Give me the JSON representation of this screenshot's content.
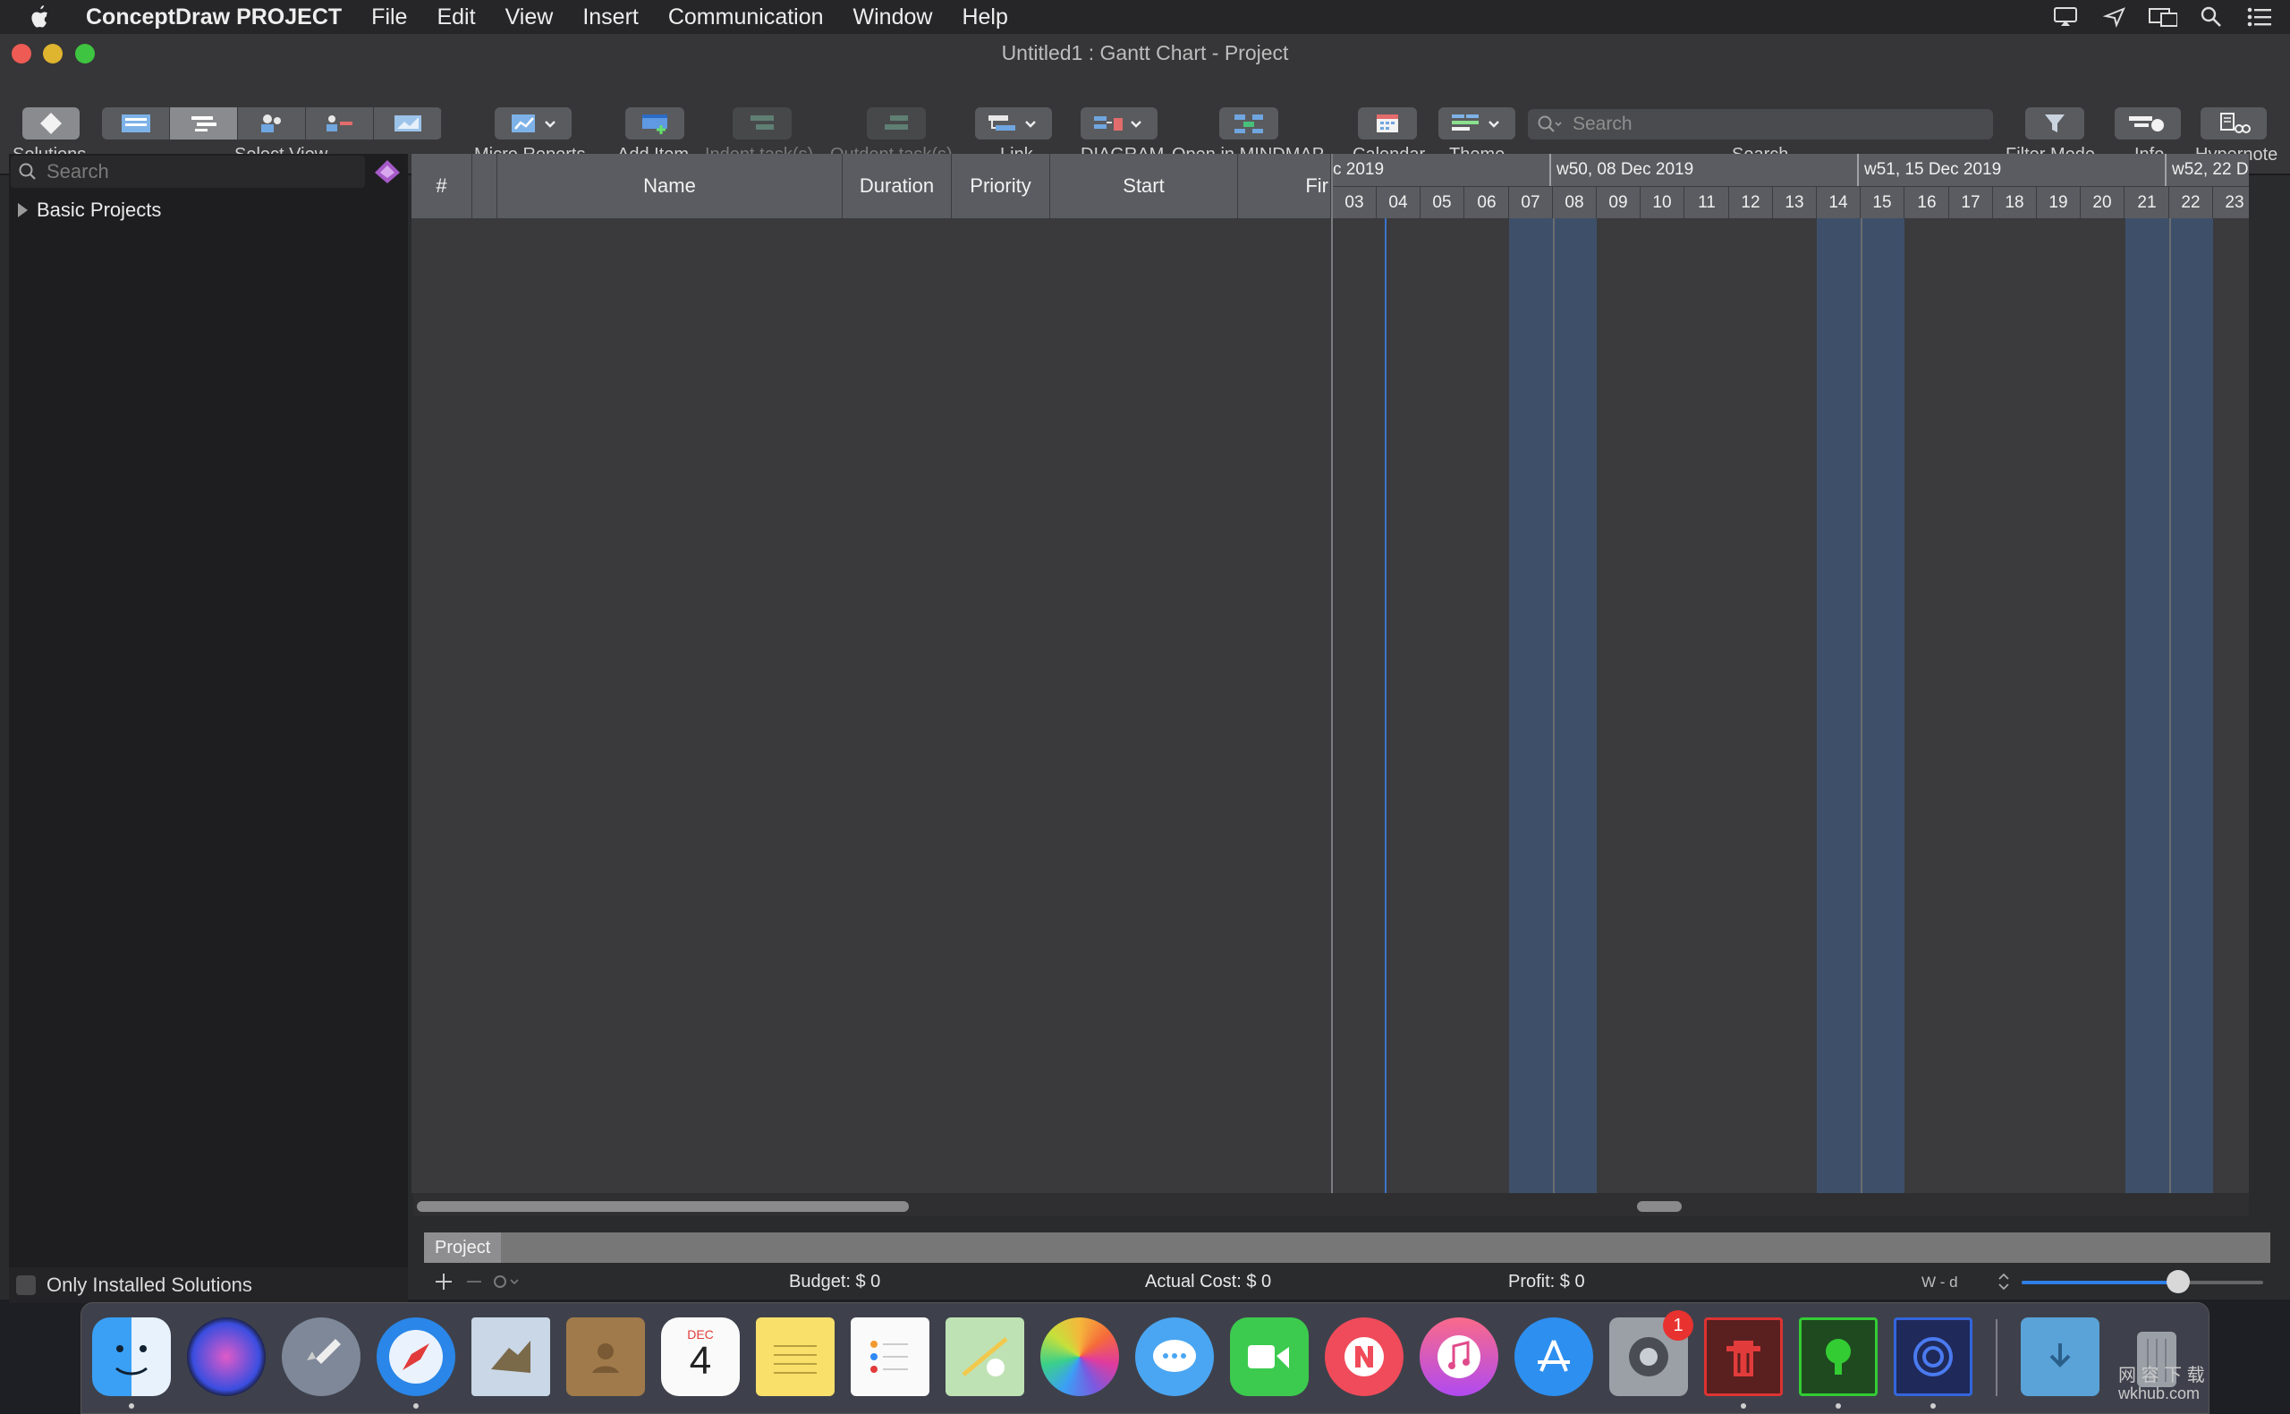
{
  "menubar": {
    "app_name": "ConceptDraw PROJECT",
    "items": [
      "File",
      "Edit",
      "View",
      "Insert",
      "Communication",
      "Window",
      "Help"
    ]
  },
  "window": {
    "title": "Untitled1 : Gantt Chart - Project"
  },
  "toolbar": {
    "solutions": "Solutions",
    "select_view": "Select View",
    "micro_reports": "Micro Reports",
    "add_item": "Add Item",
    "indent": "Indent task(s)",
    "outdent": "Outdent task(s)",
    "link": "Link",
    "diagram": "DIAGRAM",
    "open_mindmap": "Open in MINDMAP",
    "calendar": "Calendar",
    "theme": "Theme",
    "search_placeholder": "Search",
    "search_label": "Search",
    "filter_mode": "Filter Mode",
    "info": "Info",
    "hypernote": "Hypernote"
  },
  "sidebar": {
    "search_placeholder": "Search",
    "tree_item": "Basic Projects",
    "only_installed": "Only Installed Solutions"
  },
  "grid": {
    "columns": [
      "#",
      "",
      "Name",
      "Duration",
      "Priority",
      "Start",
      "Fir"
    ]
  },
  "gantt": {
    "weeks": [
      "c 2019",
      "w50, 08 Dec 2019",
      "w51, 15 Dec 2019",
      "w52, 22 De"
    ],
    "days": [
      "03",
      "04",
      "05",
      "06",
      "07",
      "08",
      "09",
      "10",
      "11",
      "12",
      "13",
      "14",
      "15",
      "16",
      "17",
      "18",
      "19",
      "20",
      "21",
      "22",
      "23"
    ]
  },
  "tabs": {
    "project": "Project"
  },
  "status": {
    "budget": "Budget: $ 0",
    "actual_cost": "Actual Cost: $ 0",
    "profit": "Profit: $ 0",
    "scale": "W - d"
  },
  "dock": {
    "calendar_month": "DEC",
    "calendar_day": "4",
    "badge": "1"
  },
  "watermark": {
    "line1": "网 容 下 载",
    "line2": "wkhub.com"
  },
  "colors": {
    "weekend": "#40587a",
    "today_line": "#3a73c8",
    "accent": "#2f7fe6"
  }
}
